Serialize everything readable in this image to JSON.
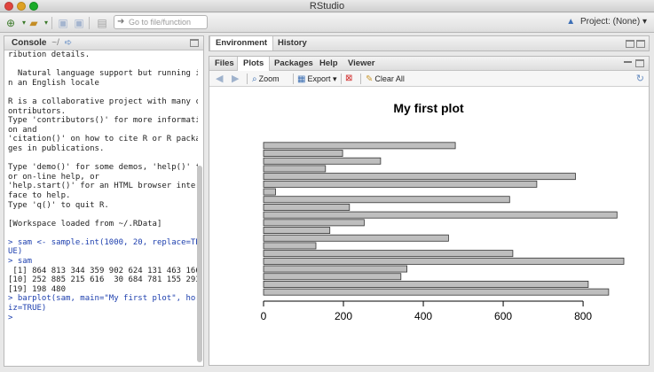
{
  "window": {
    "title": "RStudio"
  },
  "toolbar": {
    "goto_placeholder": "Go to file/function",
    "project_label": "Project: (None)",
    "icons": [
      "new-file-icon",
      "open-folder-icon",
      "save-icon",
      "save-all-icon",
      "print-icon",
      "goto-search-icon"
    ]
  },
  "console": {
    "tab_label": "Console",
    "path": "~/",
    "lines": [
      {
        "text": "ribution details.",
        "kind": "output"
      },
      {
        "text": "",
        "kind": "output"
      },
      {
        "text": "  Natural language support but running i",
        "kind": "output"
      },
      {
        "text": "n an English locale",
        "kind": "output"
      },
      {
        "text": "",
        "kind": "output"
      },
      {
        "text": "R is a collaborative project with many c",
        "kind": "output"
      },
      {
        "text": "ontributors.",
        "kind": "output"
      },
      {
        "text": "Type 'contributors()' for more informati",
        "kind": "output"
      },
      {
        "text": "on and",
        "kind": "output"
      },
      {
        "text": "'citation()' on how to cite R or R packa",
        "kind": "output"
      },
      {
        "text": "ges in publications.",
        "kind": "output"
      },
      {
        "text": "",
        "kind": "output"
      },
      {
        "text": "Type 'demo()' for some demos, 'help()' f",
        "kind": "output"
      },
      {
        "text": "or on-line help, or",
        "kind": "output"
      },
      {
        "text": "'help.start()' for an HTML browser inter",
        "kind": "output"
      },
      {
        "text": "face to help.",
        "kind": "output"
      },
      {
        "text": "Type 'q()' to quit R.",
        "kind": "output"
      },
      {
        "text": "",
        "kind": "output"
      },
      {
        "text": "[Workspace loaded from ~/.RData]",
        "kind": "output"
      },
      {
        "text": "",
        "kind": "output"
      },
      {
        "text": "> sam <- sample.int(1000, 20, replace=TR",
        "kind": "input"
      },
      {
        "text": "UE)",
        "kind": "input"
      },
      {
        "text": "> sam",
        "kind": "input"
      },
      {
        "text": " [1] 864 813 344 359 902 624 131 463 166",
        "kind": "output"
      },
      {
        "text": "[10] 252 885 215 616  30 684 781 155 293",
        "kind": "output"
      },
      {
        "text": "[19] 198 480",
        "kind": "output"
      },
      {
        "text": "> barplot(sam, main=\"My first plot\", hor",
        "kind": "input"
      },
      {
        "text": "iz=TRUE)",
        "kind": "input"
      },
      {
        "text": ">",
        "kind": "input"
      }
    ]
  },
  "env_pane": {
    "tabs": [
      "Environment",
      "History"
    ],
    "active": 0
  },
  "plots_pane": {
    "tabs": [
      "Files",
      "Plots",
      "Packages",
      "Help",
      "Viewer"
    ],
    "active": 1,
    "toolbar": {
      "zoom": "Zoom",
      "export": "Export",
      "clear_all": "Clear All"
    }
  },
  "chart_data": {
    "type": "bar",
    "orientation": "horizontal",
    "title": "My first plot",
    "values": [
      864,
      813,
      344,
      359,
      902,
      624,
      131,
      463,
      166,
      252,
      885,
      215,
      616,
      30,
      684,
      781,
      155,
      293,
      198,
      480
    ],
    "xlim": [
      0,
      902
    ],
    "x_ticks": [
      0,
      200,
      400,
      600,
      800
    ],
    "bar_color": "#bebebe",
    "xlabel": "",
    "ylabel": ""
  }
}
